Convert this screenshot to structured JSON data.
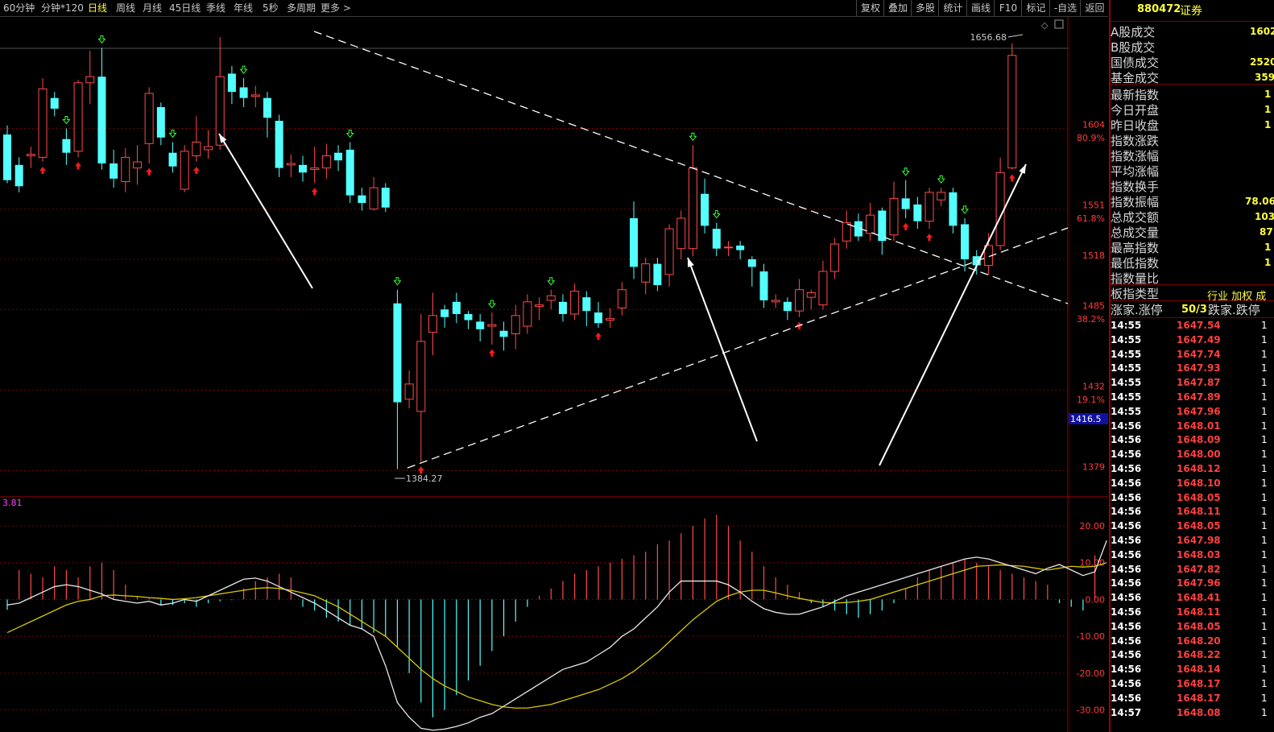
{
  "toolbar": {
    "tabs": [
      "60分钟",
      "分钟*120",
      "日线",
      "周线",
      "月线",
      "45日线",
      "季线",
      "年线",
      "5秒",
      "多周期",
      "更多 >"
    ],
    "active_tab": "日线",
    "right_buttons": [
      "复权",
      "叠加",
      "多股",
      "统计",
      "画线",
      "F10",
      "标记",
      "-自选",
      "返回"
    ]
  },
  "price_axis": {
    "labels": [
      "1604",
      "1551",
      "1518",
      "1485",
      "1432",
      "1379"
    ],
    "percent_labels": [
      "80.9%",
      "61.8%",
      "38.2%",
      "19.1%"
    ],
    "current_price_tag": "1416.5"
  },
  "annotations": {
    "high_label": "1656.68",
    "low_label": "1384.27"
  },
  "macd": {
    "indicator_label": "3.81",
    "axis_labels": [
      "20.00",
      "10.00",
      "0.00",
      "-10.00",
      "-20.00",
      "-30.00"
    ]
  },
  "panel": {
    "code": "880472",
    "name": "证券",
    "stats": [
      {
        "label": "A股成交",
        "value": "1602"
      },
      {
        "label": "B股成交",
        "value": ""
      },
      {
        "label": "国债成交",
        "value": "2520"
      },
      {
        "label": "基金成交",
        "value": "359"
      },
      {
        "label": "最新指数",
        "value": "1"
      },
      {
        "label": "今日开盘",
        "value": "1"
      },
      {
        "label": "昨日收盘",
        "value": "1"
      },
      {
        "label": "指数涨跌",
        "value": ""
      },
      {
        "label": "指数涨幅",
        "value": ""
      },
      {
        "label": "平均涨幅",
        "value": ""
      },
      {
        "label": "指数换手",
        "value": ""
      },
      {
        "label": "指数振幅",
        "value": "78.06"
      },
      {
        "label": "总成交额",
        "value": "103"
      },
      {
        "label": "总成交量",
        "value": "87"
      },
      {
        "label": "最高指数",
        "value": "1"
      },
      {
        "label": "最低指数",
        "value": "1"
      },
      {
        "label": "指数量比",
        "value": ""
      }
    ],
    "board_type_label": "板指类型",
    "board_type_value": "行业 加权 成",
    "up_down_label": "涨家.涨停",
    "up_down_value": "50/3",
    "down_label": "跌家.跌停",
    "ticks": [
      {
        "time": "14:55",
        "price": "1647.54"
      },
      {
        "time": "14:55",
        "price": "1647.49"
      },
      {
        "time": "14:55",
        "price": "1647.74"
      },
      {
        "time": "14:55",
        "price": "1647.93"
      },
      {
        "time": "14:55",
        "price": "1647.87"
      },
      {
        "time": "14:55",
        "price": "1647.89"
      },
      {
        "time": "14:55",
        "price": "1647.96"
      },
      {
        "time": "14:56",
        "price": "1648.01"
      },
      {
        "time": "14:56",
        "price": "1648.09"
      },
      {
        "time": "14:56",
        "price": "1648.00"
      },
      {
        "time": "14:56",
        "price": "1648.12"
      },
      {
        "time": "14:56",
        "price": "1648.10"
      },
      {
        "time": "14:56",
        "price": "1648.05"
      },
      {
        "time": "14:56",
        "price": "1648.11"
      },
      {
        "time": "14:56",
        "price": "1648.05"
      },
      {
        "time": "14:56",
        "price": "1647.98"
      },
      {
        "time": "14:56",
        "price": "1648.03"
      },
      {
        "time": "14:56",
        "price": "1647.82"
      },
      {
        "time": "14:56",
        "price": "1647.96"
      },
      {
        "time": "14:56",
        "price": "1648.41"
      },
      {
        "time": "14:56",
        "price": "1648.11"
      },
      {
        "time": "14:56",
        "price": "1648.05"
      },
      {
        "time": "14:56",
        "price": "1648.20"
      },
      {
        "time": "14:56",
        "price": "1648.22"
      },
      {
        "time": "14:56",
        "price": "1648.14"
      },
      {
        "time": "14:56",
        "price": "1648.17"
      },
      {
        "time": "14:56",
        "price": "1648.17"
      },
      {
        "time": "14:57",
        "price": "1648.08"
      }
    ],
    "tick_volumes": [
      "1",
      "1",
      "1",
      "1",
      "1",
      "1",
      "1",
      "1",
      "1",
      "1",
      "1",
      "1",
      "1",
      "1",
      "1",
      "1",
      "1",
      "1",
      "1",
      "1",
      "1",
      "1",
      "1",
      "1",
      "1",
      "1",
      "1",
      "1"
    ]
  },
  "colors": {
    "up": "#ff4a4a",
    "down": "#54ffff",
    "grid": "#7a0000",
    "axis_text": "#ff3c3c",
    "dif": "#e8e8e8",
    "dea": "#d8c800",
    "trendline": "#ffffff"
  },
  "chart_data": {
    "type": "candlestick",
    "ylim": [
      1365,
      1672
    ],
    "candles": [
      {
        "o": 1600,
        "c": 1570,
        "h": 1606,
        "l": 1568
      },
      {
        "o": 1580,
        "c": 1566,
        "h": 1585,
        "l": 1562
      },
      {
        "o": 1586,
        "c": 1587,
        "h": 1592,
        "l": 1578
      },
      {
        "o": 1585,
        "c": 1630,
        "h": 1637,
        "l": 1582
      },
      {
        "o": 1624,
        "c": 1617,
        "h": 1628,
        "l": 1612
      },
      {
        "o": 1597,
        "c": 1588,
        "h": 1604,
        "l": 1580
      },
      {
        "o": 1589,
        "c": 1634,
        "h": 1636,
        "l": 1585
      },
      {
        "o": 1634,
        "c": 1638,
        "h": 1655,
        "l": 1620
      },
      {
        "o": 1638,
        "c": 1581,
        "h": 1657,
        "l": 1577
      },
      {
        "o": 1581,
        "c": 1571,
        "h": 1590,
        "l": 1565
      },
      {
        "o": 1569,
        "c": 1585,
        "h": 1591,
        "l": 1562
      },
      {
        "o": 1578,
        "c": 1582,
        "h": 1593,
        "l": 1567
      },
      {
        "o": 1594,
        "c": 1627,
        "h": 1631,
        "l": 1581
      },
      {
        "o": 1618,
        "c": 1598,
        "h": 1621,
        "l": 1593
      },
      {
        "o": 1588,
        "c": 1579,
        "h": 1595,
        "l": 1575
      },
      {
        "o": 1564,
        "c": 1589,
        "h": 1593,
        "l": 1562
      },
      {
        "o": 1586,
        "c": 1595,
        "h": 1612,
        "l": 1582
      },
      {
        "o": 1590,
        "c": 1592,
        "h": 1603,
        "l": 1584
      },
      {
        "o": 1593,
        "c": 1638,
        "h": 1664,
        "l": 1590
      },
      {
        "o": 1640,
        "c": 1628,
        "h": 1645,
        "l": 1620
      },
      {
        "o": 1631,
        "c": 1624,
        "h": 1637,
        "l": 1618
      },
      {
        "o": 1625,
        "c": 1626,
        "h": 1632,
        "l": 1618
      },
      {
        "o": 1624,
        "c": 1611,
        "h": 1628,
        "l": 1598
      },
      {
        "o": 1609,
        "c": 1578,
        "h": 1613,
        "l": 1572
      },
      {
        "o": 1580,
        "c": 1581,
        "h": 1587,
        "l": 1572
      },
      {
        "o": 1580,
        "c": 1575,
        "h": 1586,
        "l": 1569
      },
      {
        "o": 1577,
        "c": 1578,
        "h": 1592,
        "l": 1568
      },
      {
        "o": 1578,
        "c": 1586,
        "h": 1594,
        "l": 1571
      },
      {
        "o": 1588,
        "c": 1583,
        "h": 1593,
        "l": 1576
      },
      {
        "o": 1590,
        "c": 1560,
        "h": 1595,
        "l": 1555
      },
      {
        "o": 1560,
        "c": 1555,
        "h": 1565,
        "l": 1550
      },
      {
        "o": 1551,
        "c": 1565,
        "h": 1572,
        "l": 1550
      },
      {
        "o": 1565,
        "c": 1552,
        "h": 1568,
        "l": 1549
      },
      {
        "o": 1489,
        "c": 1424,
        "h": 1498,
        "l": 1380
      },
      {
        "o": 1426,
        "c": 1436,
        "h": 1445,
        "l": 1420
      },
      {
        "o": 1418,
        "c": 1464,
        "h": 1482,
        "l": 1385
      },
      {
        "o": 1470,
        "c": 1481,
        "h": 1496,
        "l": 1455
      },
      {
        "o": 1485,
        "c": 1480,
        "h": 1488,
        "l": 1473
      },
      {
        "o": 1490,
        "c": 1482,
        "h": 1496,
        "l": 1476
      },
      {
        "o": 1482,
        "c": 1478,
        "h": 1484,
        "l": 1472
      },
      {
        "o": 1477,
        "c": 1472,
        "h": 1482,
        "l": 1464
      },
      {
        "o": 1474,
        "c": 1475,
        "h": 1483,
        "l": 1462
      },
      {
        "o": 1471,
        "c": 1467,
        "h": 1477,
        "l": 1458
      },
      {
        "o": 1469,
        "c": 1481,
        "h": 1488,
        "l": 1459
      },
      {
        "o": 1474,
        "c": 1490,
        "h": 1495,
        "l": 1469
      },
      {
        "o": 1487,
        "c": 1488,
        "h": 1493,
        "l": 1478
      },
      {
        "o": 1491,
        "c": 1494,
        "h": 1498,
        "l": 1485
      },
      {
        "o": 1490,
        "c": 1482,
        "h": 1495,
        "l": 1477
      },
      {
        "o": 1482,
        "c": 1497,
        "h": 1502,
        "l": 1478
      },
      {
        "o": 1493,
        "c": 1484,
        "h": 1497,
        "l": 1474
      },
      {
        "o": 1483,
        "c": 1476,
        "h": 1490,
        "l": 1473
      },
      {
        "o": 1478,
        "c": 1479,
        "h": 1486,
        "l": 1473
      },
      {
        "o": 1486,
        "c": 1498,
        "h": 1503,
        "l": 1481
      },
      {
        "o": 1545,
        "c": 1513,
        "h": 1556,
        "l": 1505
      },
      {
        "o": 1503,
        "c": 1515,
        "h": 1519,
        "l": 1495
      },
      {
        "o": 1515,
        "c": 1501,
        "h": 1519,
        "l": 1497
      },
      {
        "o": 1508,
        "c": 1538,
        "h": 1541,
        "l": 1500
      },
      {
        "o": 1525,
        "c": 1545,
        "h": 1550,
        "l": 1518
      },
      {
        "o": 1525,
        "c": 1578,
        "h": 1593,
        "l": 1520
      },
      {
        "o": 1561,
        "c": 1540,
        "h": 1571,
        "l": 1535
      },
      {
        "o": 1538,
        "c": 1525,
        "h": 1542,
        "l": 1520
      },
      {
        "o": 1526,
        "c": 1526,
        "h": 1530,
        "l": 1520
      },
      {
        "o": 1527,
        "c": 1524,
        "h": 1530,
        "l": 1518
      },
      {
        "o": 1518,
        "c": 1513,
        "h": 1520,
        "l": 1500
      },
      {
        "o": 1510,
        "c": 1491,
        "h": 1515,
        "l": 1486
      },
      {
        "o": 1490,
        "c": 1491,
        "h": 1495,
        "l": 1486
      },
      {
        "o": 1490,
        "c": 1484,
        "h": 1493,
        "l": 1478
      },
      {
        "o": 1484,
        "c": 1498,
        "h": 1505,
        "l": 1480
      },
      {
        "o": 1493,
        "c": 1496,
        "h": 1498,
        "l": 1485
      },
      {
        "o": 1488,
        "c": 1510,
        "h": 1517,
        "l": 1485
      },
      {
        "o": 1510,
        "c": 1528,
        "h": 1532,
        "l": 1505
      },
      {
        "o": 1530,
        "c": 1542,
        "h": 1550,
        "l": 1525
      },
      {
        "o": 1543,
        "c": 1533,
        "h": 1548,
        "l": 1530
      },
      {
        "o": 1535,
        "c": 1547,
        "h": 1555,
        "l": 1530
      },
      {
        "o": 1550,
        "c": 1530,
        "h": 1552,
        "l": 1521
      },
      {
        "o": 1534,
        "c": 1558,
        "h": 1569,
        "l": 1530
      },
      {
        "o": 1558,
        "c": 1551,
        "h": 1570,
        "l": 1545
      },
      {
        "o": 1554,
        "c": 1543,
        "h": 1559,
        "l": 1538
      },
      {
        "o": 1543,
        "c": 1562,
        "h": 1565,
        "l": 1538
      },
      {
        "o": 1557,
        "c": 1562,
        "h": 1565,
        "l": 1553
      },
      {
        "o": 1562,
        "c": 1540,
        "h": 1565,
        "l": 1535
      },
      {
        "o": 1541,
        "c": 1518,
        "h": 1545,
        "l": 1510
      },
      {
        "o": 1520,
        "c": 1514,
        "h": 1524,
        "l": 1508
      },
      {
        "o": 1514,
        "c": 1527,
        "h": 1535,
        "l": 1508
      },
      {
        "o": 1527,
        "c": 1575,
        "h": 1585,
        "l": 1524
      },
      {
        "o": 1578,
        "c": 1652,
        "h": 1660,
        "l": 1577
      }
    ],
    "macd_hist": [
      -2.8,
      8,
      7,
      6,
      9,
      8,
      6,
      9,
      10,
      8,
      4,
      1,
      0.5,
      -1.5,
      -1.5,
      -1,
      -2,
      -1,
      -0.5,
      -0.2,
      3,
      5,
      6,
      7,
      6,
      -2,
      -3,
      -5,
      -6,
      -7,
      -8,
      -9,
      -10,
      -13,
      -20,
      -28,
      -32,
      -30,
      -26,
      -22,
      -18,
      -14,
      -10,
      -6,
      -2,
      1,
      3,
      5,
      7,
      8,
      9,
      10,
      11,
      12,
      13,
      15,
      16,
      18,
      20,
      22,
      23,
      20,
      16,
      13,
      9,
      6,
      4,
      2,
      -1,
      -2,
      -3,
      -4,
      -5,
      -4,
      -3,
      -1,
      3,
      6,
      8,
      9,
      10,
      11,
      10,
      9,
      8,
      7,
      6,
      5,
      4,
      -1,
      -2,
      -3,
      12
    ],
    "dif": [
      -1.5,
      -1,
      0.5,
      2,
      3.5,
      4,
      3.5,
      2.5,
      1.5,
      0,
      -0.5,
      -1,
      -0.5,
      -1.5,
      -1,
      0,
      -0.5,
      1,
      2.5,
      4,
      5.5,
      5.8,
      5,
      3.5,
      2,
      0.5,
      -1,
      -3,
      -5,
      -7,
      -8,
      -10,
      -18,
      -28,
      -32,
      -35,
      -35.5,
      -35.2,
      -34.5,
      -33.5,
      -32,
      -31,
      -29,
      -27,
      -25,
      -23,
      -21,
      -19,
      -18,
      -17,
      -15,
      -13,
      -10,
      -8,
      -5,
      -2,
      2,
      5,
      5,
      5,
      5,
      4,
      2,
      -0.5,
      -2.5,
      -3.5,
      -4,
      -4,
      -3,
      -2,
      -0.5,
      1,
      2,
      3,
      4,
      5,
      6,
      7,
      8,
      9,
      10,
      11,
      11.5,
      11,
      10,
      9,
      8,
      7,
      8.5,
      9.5,
      8,
      6.5,
      7.5,
      16
    ],
    "dea": [
      -9,
      -7.5,
      -6,
      -4.5,
      -3,
      -1.5,
      -0.5,
      0,
      1,
      1.2,
      1,
      0.8,
      0.5,
      0.3,
      0,
      0.2,
      0.5,
      1,
      1.5,
      2,
      2.5,
      3,
      3.2,
      3,
      2.5,
      1.8,
      1,
      -0.5,
      -2,
      -4,
      -6,
      -8,
      -10,
      -13,
      -16,
      -19,
      -21.5,
      -23.5,
      -25,
      -26.5,
      -27.5,
      -28.5,
      -29.2,
      -29.5,
      -29.5,
      -29,
      -28.5,
      -27.5,
      -26.5,
      -25.5,
      -24.5,
      -23,
      -21.5,
      -19.5,
      -17,
      -14.5,
      -11.5,
      -8.5,
      -5.5,
      -3,
      -0.5,
      1,
      2,
      2.5,
      2.5,
      1.8,
      1,
      0.3,
      -0.3,
      -0.8,
      -1,
      -0.8,
      -0.5,
      0,
      1,
      2,
      3,
      4,
      5,
      6,
      7,
      8,
      9,
      9.2,
      9.4,
      9.2,
      9,
      8.5,
      8,
      8.5,
      9,
      8.8,
      9,
      10
    ]
  }
}
